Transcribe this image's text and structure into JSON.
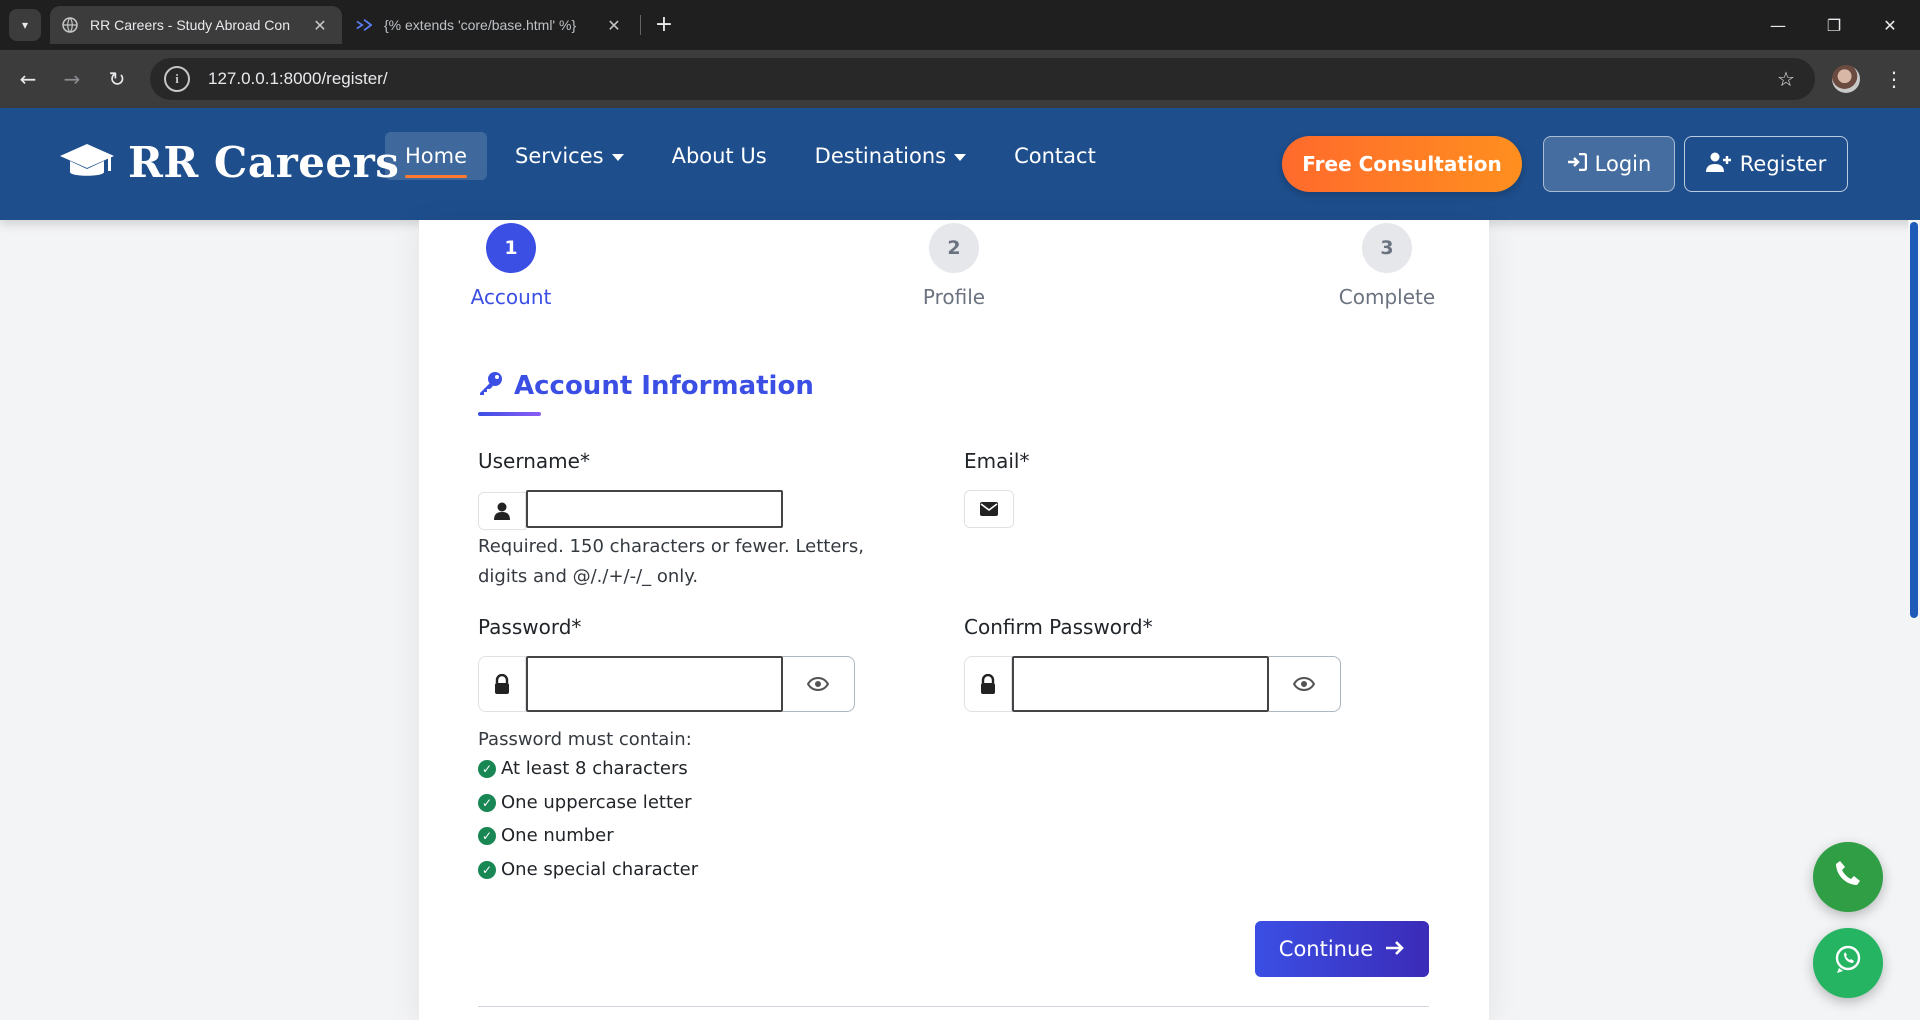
{
  "browser": {
    "tabs": [
      {
        "title": "RR Careers - Study Abroad Con",
        "active": true
      },
      {
        "title": "{% extends 'core/base.html' %}",
        "active": false
      }
    ],
    "url": "127.0.0.1:8000/register/"
  },
  "site": {
    "brand": "RR Careers",
    "nav": [
      {
        "label": "Home",
        "active": true,
        "dropdown": false
      },
      {
        "label": "Services",
        "active": false,
        "dropdown": true
      },
      {
        "label": "About Us",
        "active": false,
        "dropdown": false
      },
      {
        "label": "Destinations",
        "active": false,
        "dropdown": true
      },
      {
        "label": "Contact",
        "active": false,
        "dropdown": false
      }
    ],
    "consult_label": "Free Consultation",
    "login_label": "Login",
    "register_label": "Register"
  },
  "steps": [
    {
      "num": "1",
      "label": "Account",
      "state": "active"
    },
    {
      "num": "2",
      "label": "Profile",
      "state": "pending"
    },
    {
      "num": "3",
      "label": "Complete",
      "state": "pending"
    }
  ],
  "form": {
    "section_title": "Account Information",
    "username_label": "Username*",
    "username_value": "",
    "username_help": "Required. 150 characters or fewer. Letters, digits and @/./+/-/_ only.",
    "email_label": "Email*",
    "password_label": "Password*",
    "confirm_label": "Confirm Password*",
    "pw_req_title": "Password must contain:",
    "pw_requirements": [
      "At least 8 characters",
      "One uppercase letter",
      "One number",
      "One special character"
    ],
    "continue_label": "Continue"
  },
  "colors": {
    "nav_bg": "#1e4e8c",
    "accent": "#3b4fe4",
    "consult": "#ff7a2f",
    "success": "#198754"
  }
}
